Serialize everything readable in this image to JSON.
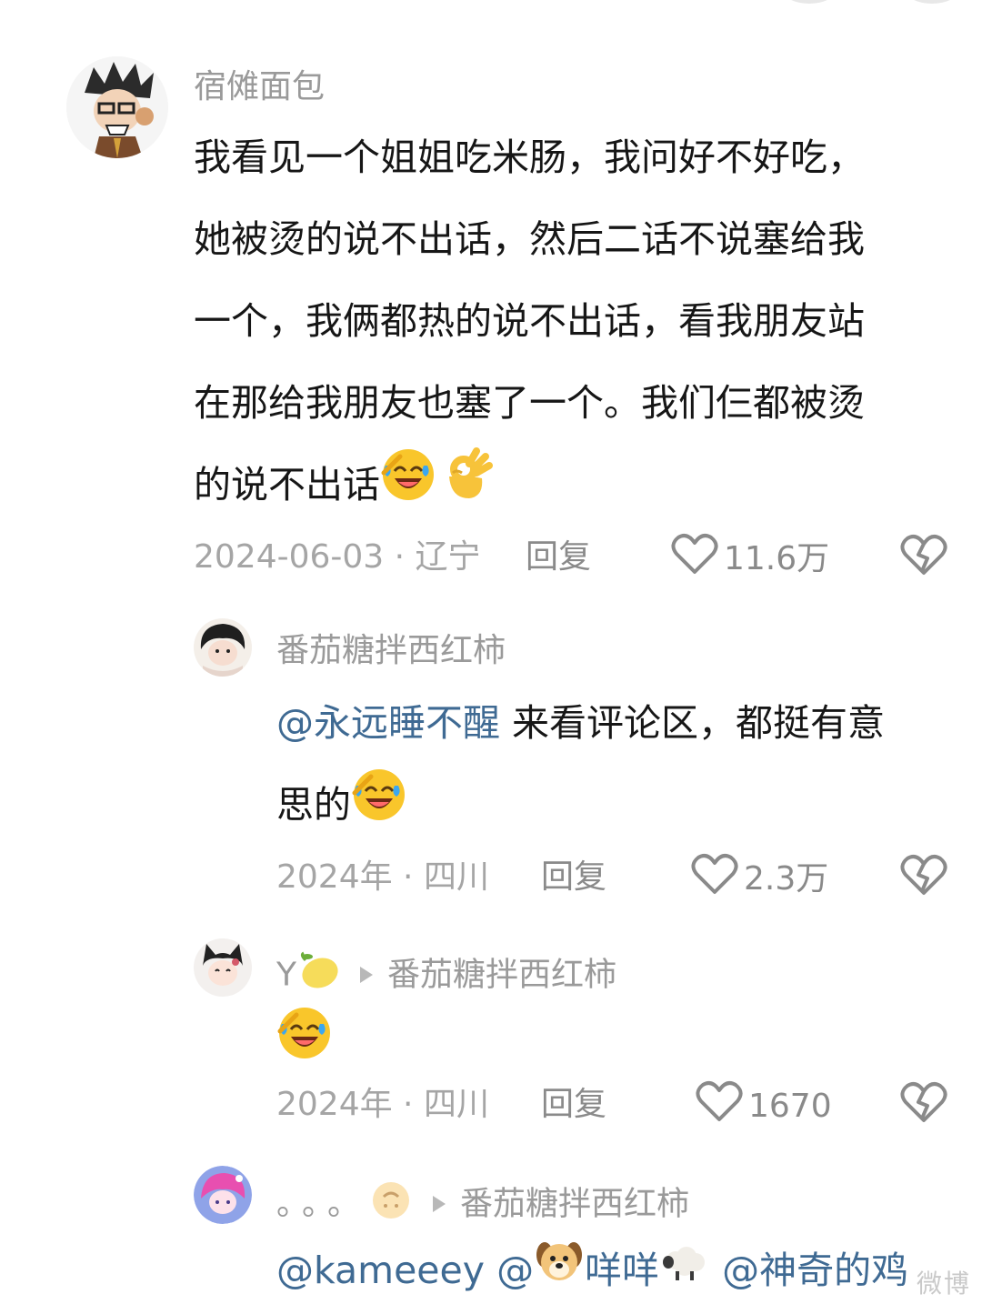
{
  "comments": [
    {
      "username": "宿傩面包",
      "lines": [
        "我看见一个姐姐吃米肠，我问好不好吃，",
        "她被烫的说不出话，然后二话不说塞给我",
        "一个，我俩都热的说不出话，看我朋友站",
        "在那给我朋友也塞了一个。我们仨都被烫",
        "的说不出话"
      ],
      "meta": "2024-06-03 · 辽宁",
      "reply": "回复",
      "likes": "11.6万"
    },
    {
      "username": "番茄糖拌西红柿",
      "mention": "@永远睡不醒",
      "text_after_mention": " 来看评论区，都挺有意",
      "line2": "思的",
      "meta": "2024年 · 四川",
      "reply": "回复",
      "likes": "2.3万"
    },
    {
      "username": "Y",
      "reply_to": "番茄糖拌西红柿",
      "meta": "2024年 · 四川",
      "reply": "回复",
      "likes": "1670"
    },
    {
      "username": "。。。",
      "reply_to": "番茄糖拌西红柿",
      "mention1": "@kameeey",
      "mention2": "@",
      "name2": "咩咩",
      "mention3": "@神奇的鸡"
    }
  ],
  "watermark": "微博"
}
